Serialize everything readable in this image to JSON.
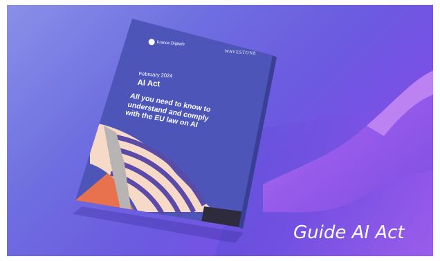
{
  "cover": {
    "publisher_logo": "France Digitale",
    "publisher_logo_sub": "",
    "partner_logo": "WAVESTONE",
    "date": "February 2024",
    "title": "AI Act",
    "subtitle_lines": [
      "All you need to know to",
      "understand and comply",
      "with the EU law on AI"
    ]
  },
  "caption": "Guide AI Act",
  "colors": {
    "background": "#6f62e2",
    "cover": "#4d56b8",
    "accent_orange": "#e8724e",
    "accent_cream": "#f6d9c7",
    "accent_purple": "#5c4aa8"
  }
}
